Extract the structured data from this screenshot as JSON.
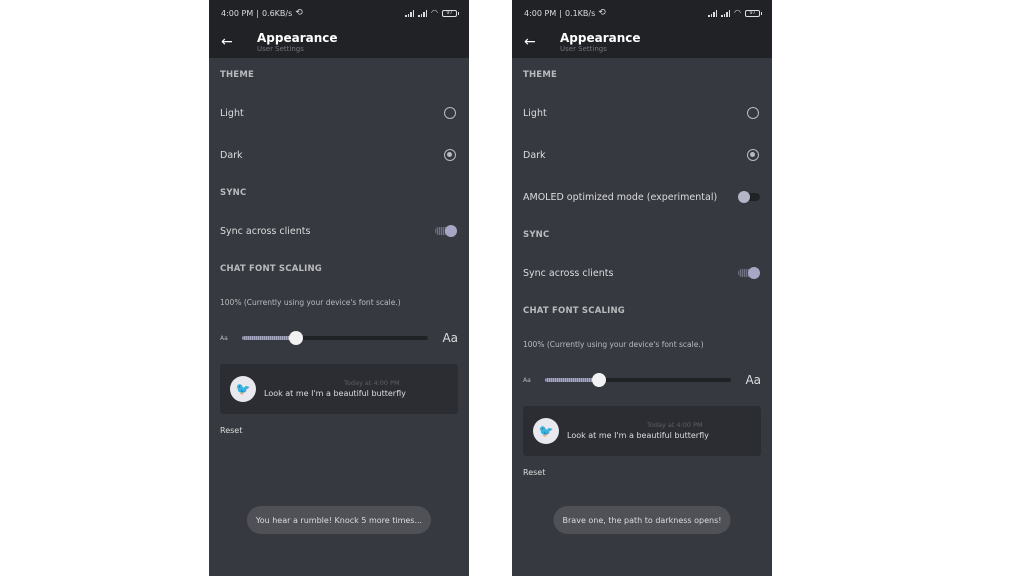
{
  "screens": [
    {
      "status": {
        "time": "4:00 PM",
        "speed": "0.6KB/s",
        "battery": "97"
      },
      "header": {
        "title": "Appearance",
        "subtitle": "User Settings",
        "back_icon": "arrow-left"
      },
      "theme": {
        "heading": "THEME",
        "options": [
          {
            "label": "Light",
            "selected": false
          },
          {
            "label": "Dark",
            "selected": true
          }
        ]
      },
      "sync": {
        "heading": "SYNC",
        "label": "Sync across clients",
        "enabled": true
      },
      "font": {
        "heading": "CHAT FONT SCALING",
        "note": "100% (Currently using your device's font scale.)",
        "small_label": "Aa",
        "large_label": "Aa",
        "slider_fraction": 0.29
      },
      "preview": {
        "timestamp": "Today at 4:00 PM",
        "message": "Look at me I'm a beautiful butterfly"
      },
      "reset_label": "Reset",
      "toast": "You hear a rumble! Knock 5 more times..."
    },
    {
      "status": {
        "time": "4:00 PM",
        "speed": "0.1KB/s",
        "battery": "97"
      },
      "header": {
        "title": "Appearance",
        "subtitle": "User Settings",
        "back_icon": "arrow-left"
      },
      "theme": {
        "heading": "THEME",
        "options": [
          {
            "label": "Light",
            "selected": false
          },
          {
            "label": "Dark",
            "selected": true
          }
        ],
        "amoled": {
          "label": "AMOLED optimized mode (experimental)",
          "enabled": false
        }
      },
      "sync": {
        "heading": "SYNC",
        "label": "Sync across clients",
        "enabled": true
      },
      "font": {
        "heading": "CHAT FONT SCALING",
        "note": "100% (Currently using your device's font scale.)",
        "small_label": "Aa",
        "large_label": "Aa",
        "slider_fraction": 0.29
      },
      "preview": {
        "timestamp": "Today at 4:00 PM",
        "message": "Look at me I'm a beautiful butterfly"
      },
      "reset_label": "Reset",
      "toast": "Brave one, the path to darkness opens!"
    }
  ]
}
